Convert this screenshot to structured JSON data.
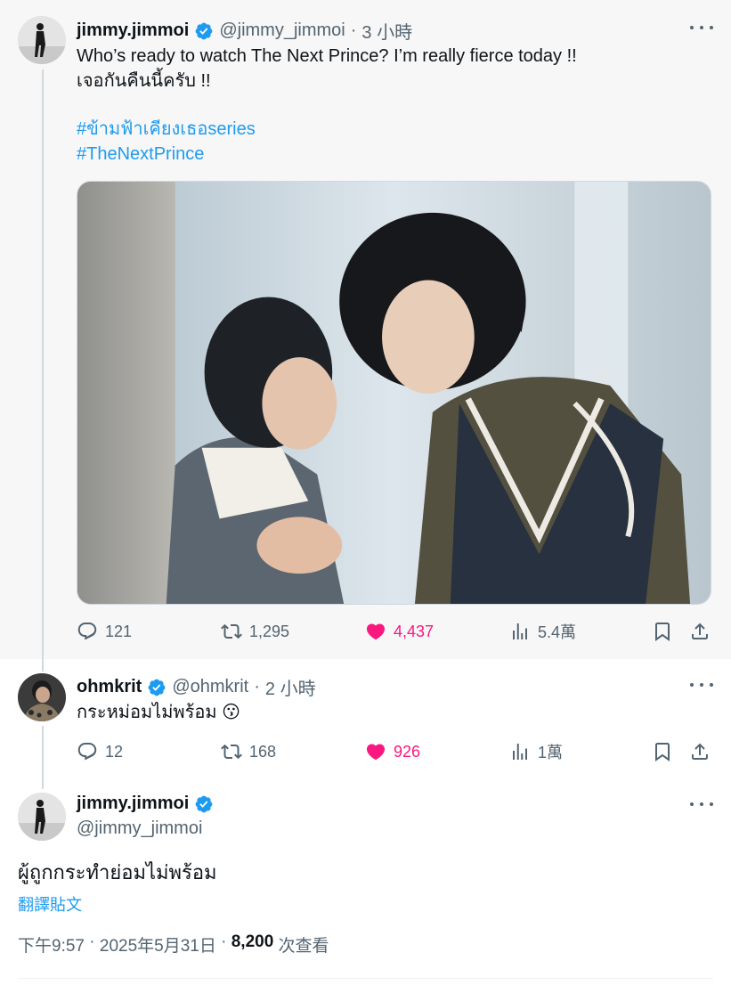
{
  "tweets": [
    {
      "name": "jimmy.jimmoi",
      "handle": "@jimmy_jimmoi",
      "separator": "·",
      "time": "3 小時",
      "lines": [
        "Who’s ready to watch The Next Prince? I’m really fierce today !!",
        "เจอกันคืนนี้ครับ !!"
      ],
      "hashtags": [
        "#ข้ามฟ้าเคียงเธอseries",
        "#TheNextPrince"
      ],
      "avatar": "person-walking-photo",
      "media": "photo-two-men-leaning-on-pillar",
      "stats": {
        "replies": "121",
        "reposts": "1,295",
        "likes": "4,437",
        "views": "5.4萬"
      }
    },
    {
      "name": "ohmkrit",
      "handle": "@ohmkrit",
      "separator": "·",
      "time": "2 小時",
      "text": "กระหม่อมไม่พร้อม 😗",
      "avatar": "man-portrait-photo",
      "stats": {
        "replies": "12",
        "reposts": "168",
        "likes": "926",
        "views": "1萬"
      }
    },
    {
      "name": "jimmy.jimmoi",
      "handle": "@jimmy_jimmoi",
      "text": "ผู้ถูกกระทำย่อมไม่พร้อม",
      "translate": "翻譯貼文",
      "meta": {
        "time": "下午9:57",
        "dot": " · ",
        "date": "2025年5月31日",
        "dot2": " · ",
        "views": "8,200",
        "views_label": " 次查看"
      },
      "avatar": "person-walking-photo"
    }
  ],
  "colors": {
    "accent": "#1d9bf0",
    "like": "#f91880",
    "muted": "#536471",
    "highlight_bg": "#f7f7f7"
  },
  "icons": [
    "verified-badge-icon",
    "more-icon",
    "reply-icon",
    "repost-icon",
    "like-icon",
    "views-icon",
    "bookmark-icon",
    "share-icon"
  ]
}
